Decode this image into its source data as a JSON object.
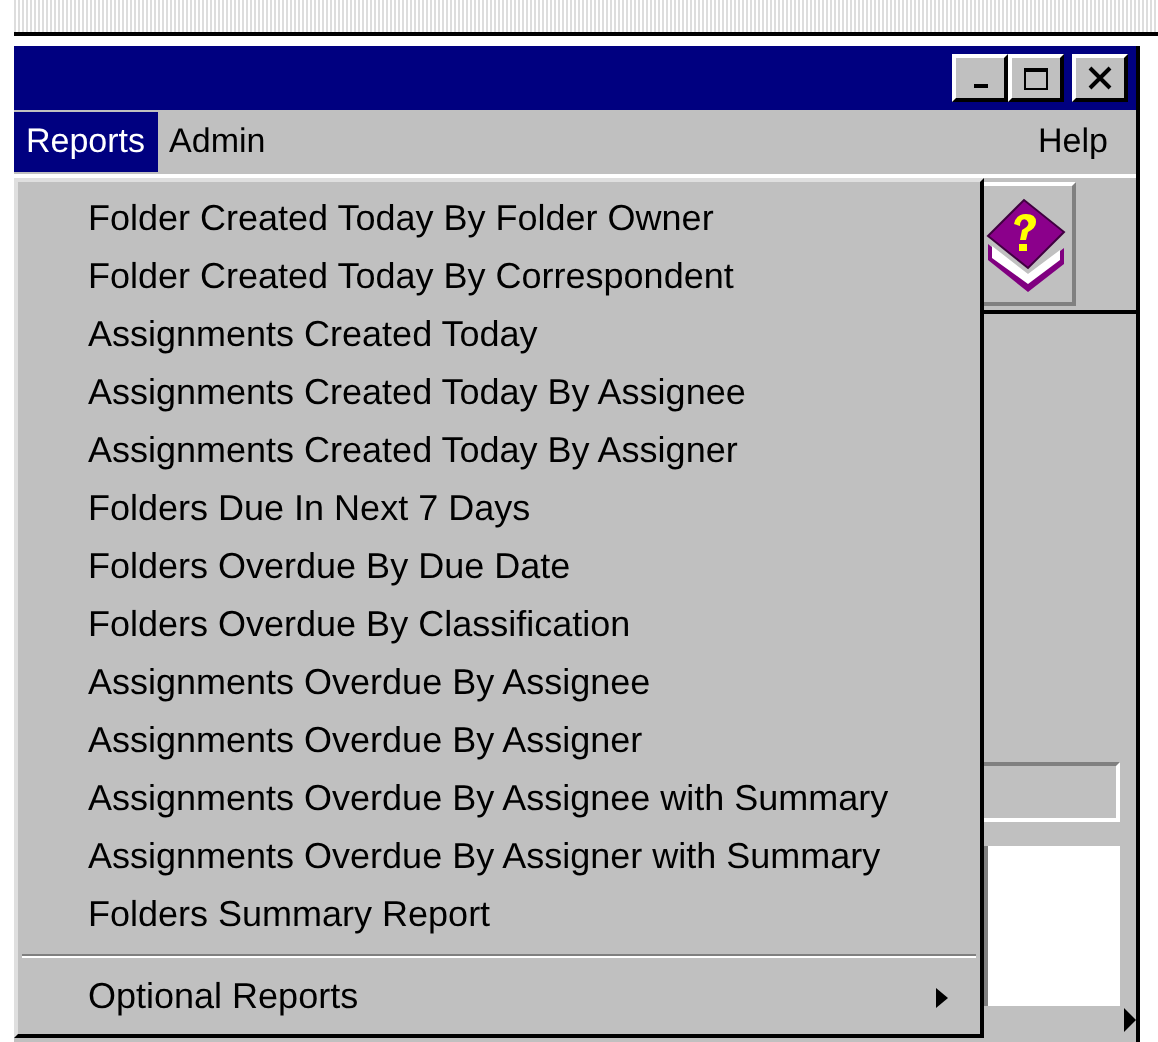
{
  "menu_bar": [
    {
      "label": "Reports",
      "selected": true
    },
    {
      "label": "Admin",
      "selected": false
    },
    {
      "label": "Help",
      "selected": false
    }
  ],
  "dropdown": [
    {
      "kind": "item",
      "label": "Folder Created Today By Folder Owner"
    },
    {
      "kind": "item",
      "label": "Folder Created Today By Correspondent"
    },
    {
      "kind": "item",
      "label": "Assignments Created Today"
    },
    {
      "kind": "item",
      "label": "Assignments Created Today By Assignee"
    },
    {
      "kind": "item",
      "label": "Assignments Created Today By Assigner"
    },
    {
      "kind": "item",
      "label": "Folders Due In Next 7 Days"
    },
    {
      "kind": "item",
      "label": "Folders Overdue By Due Date"
    },
    {
      "kind": "item",
      "label": "Folders Overdue By Classification"
    },
    {
      "kind": "item",
      "label": "Assignments Overdue By Assignee"
    },
    {
      "kind": "item",
      "label": "Assignments Overdue By Assigner"
    },
    {
      "kind": "item",
      "label": "Assignments Overdue By Assignee with Summary"
    },
    {
      "kind": "item",
      "label": "Assignments Overdue By Assigner with Summary"
    },
    {
      "kind": "item",
      "label": "Folders Summary Report"
    },
    {
      "kind": "separator"
    },
    {
      "kind": "submenu",
      "label": "Optional Reports"
    }
  ]
}
